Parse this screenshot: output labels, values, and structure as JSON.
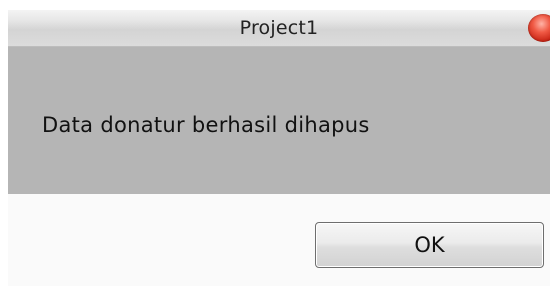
{
  "window": {
    "title": "Project1"
  },
  "message": {
    "text": "Data donatur berhasil dihapus"
  },
  "buttons": {
    "ok_label": "OK"
  },
  "colors": {
    "message_background": "#b5b5b5",
    "button_area_background": "#fafafa",
    "close_button": "#e0402d"
  },
  "icons": {
    "close": "close-icon"
  }
}
